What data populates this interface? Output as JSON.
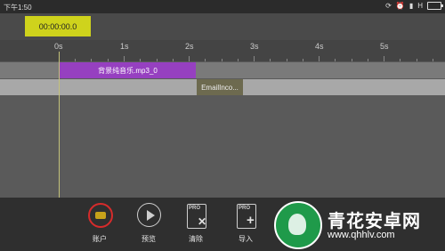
{
  "status": {
    "time": "下午1:50",
    "carrier": "H"
  },
  "timecode": "00:00:00.0",
  "ruler": {
    "labels": [
      "0s",
      "1s",
      "2s",
      "3s",
      "4s",
      "5s"
    ]
  },
  "tracks": {
    "music_clip": "背景纯音乐.mp3_0",
    "email_clip": "EmailInco..."
  },
  "toolbar": {
    "account": "账户",
    "preview": "预览",
    "clear": "清除",
    "import": "导入",
    "pro_badge": "PRO"
  },
  "watermark": {
    "title": "青花安卓网",
    "url": "www.qhhlv.com"
  },
  "colors": {
    "timecode_bg": "#cfd31c",
    "music_clip": "#9640c0",
    "email_clip": "#6d6a4f",
    "account_ring": "#d62b2b"
  }
}
